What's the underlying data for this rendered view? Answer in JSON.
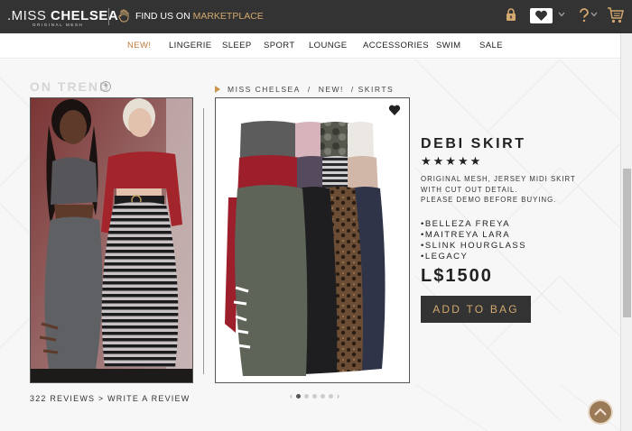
{
  "topbar": {
    "logo_prefix": ".MISS ",
    "logo_bold": "CHELSEA",
    "logo_sub": "ORIGINAL MESH",
    "findus_label": "FIND US ON ",
    "findus_highlight": "MARKETPLACE",
    "icons": [
      "hand-icon",
      "lock-icon",
      "heart-icon",
      "help-icon",
      "cart-icon"
    ]
  },
  "nav": {
    "items": [
      "NEW!",
      "LINGERIE",
      "SLEEP",
      "SPORT",
      "LOUNGE",
      "ACCESSORIES",
      "SWIM",
      "SALE"
    ]
  },
  "left": {
    "on_trend": "ON TREND",
    "plus": "+",
    "reviews": "322 REVIEWS > WRITE A REVIEW"
  },
  "breadcrumb": {
    "items": [
      "MISS CHELSEA",
      "/",
      "NEW!",
      "/ SKIRTS"
    ]
  },
  "product": {
    "title": "DEBI SKIRT",
    "stars": "★★★★★",
    "rating": 5,
    "desc_line1": "ORIGINAL MESH, JERSEY MIDI SKIRT",
    "desc_line2": "WITH CUT OUT DETAIL.",
    "desc_line3": "PLEASE DEMO BEFORE BUYING.",
    "bodies": [
      "•BELLEZA FREYA",
      "•MAITREYA LARA",
      "•SLINK HOURGLASS",
      "•LEGACY"
    ],
    "price": "L$1500",
    "add_to_bag": "ADD TO BAG"
  },
  "carousel": {
    "prev": "‹",
    "next": "›",
    "active_index": 0,
    "count": 5
  },
  "colors": {
    "topbar_bg": "#333333",
    "accent": "#d2a86e",
    "new_nav": "#c07a3a",
    "scroll_top_bg": "#9b7a58"
  }
}
